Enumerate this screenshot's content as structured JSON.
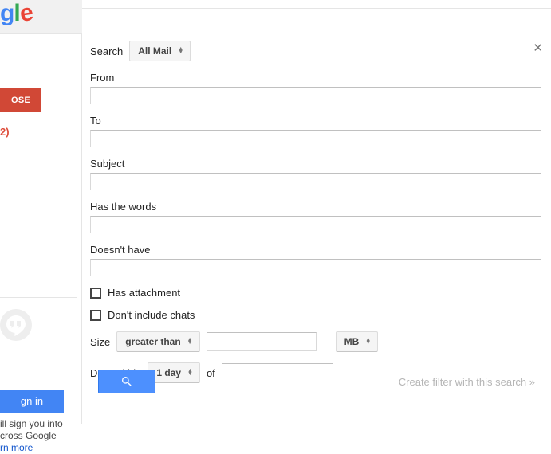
{
  "logo": {
    "g": "g",
    "l": "l",
    "e": "e"
  },
  "sidebar": {
    "compose": "OSE",
    "inbox_count": "2)",
    "signin_label": "gn in",
    "blurb_line1": "ill sign you into",
    "blurb_line2": "cross Google",
    "learn_more": "rn more"
  },
  "form": {
    "search_label": "Search",
    "search_value": "All Mail",
    "from_label": "From",
    "from_value": "",
    "to_label": "To",
    "to_value": "",
    "subject_label": "Subject",
    "subject_value": "",
    "has_words_label": "Has the words",
    "has_words_value": "",
    "doesnt_have_label": "Doesn't have",
    "doesnt_have_value": "",
    "has_attachment_label": "Has attachment",
    "dont_include_chats_label": "Don't include chats",
    "size_label": "Size",
    "size_op_value": "greater than",
    "size_val": "",
    "size_unit_value": "MB",
    "date_label": "Date within",
    "date_range_value": "1 day",
    "date_of": "of",
    "date_ref": ""
  },
  "actions": {
    "create_filter": "Create filter with this search »"
  }
}
